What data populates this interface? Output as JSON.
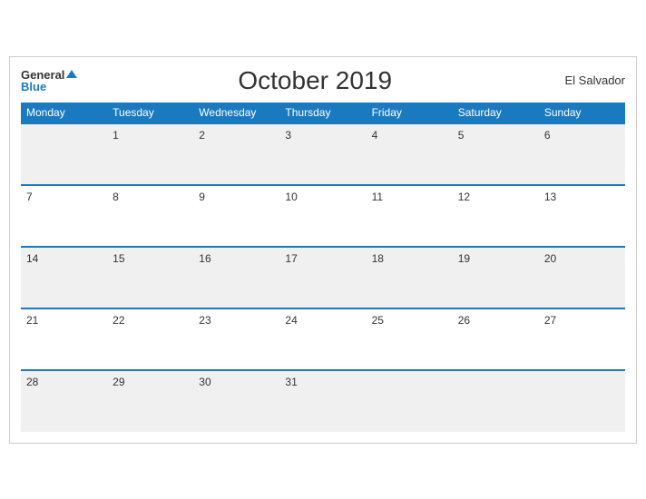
{
  "header": {
    "logo_general": "General",
    "logo_blue": "Blue",
    "month_title": "October 2019",
    "country": "El Salvador"
  },
  "weekdays": [
    "Monday",
    "Tuesday",
    "Wednesday",
    "Thursday",
    "Friday",
    "Saturday",
    "Sunday"
  ],
  "weeks": [
    [
      "",
      "1",
      "2",
      "3",
      "4",
      "5",
      "6"
    ],
    [
      "7",
      "8",
      "9",
      "10",
      "11",
      "12",
      "13"
    ],
    [
      "14",
      "15",
      "16",
      "17",
      "18",
      "19",
      "20"
    ],
    [
      "21",
      "22",
      "23",
      "24",
      "25",
      "26",
      "27"
    ],
    [
      "28",
      "29",
      "30",
      "31",
      "",
      "",
      ""
    ]
  ]
}
